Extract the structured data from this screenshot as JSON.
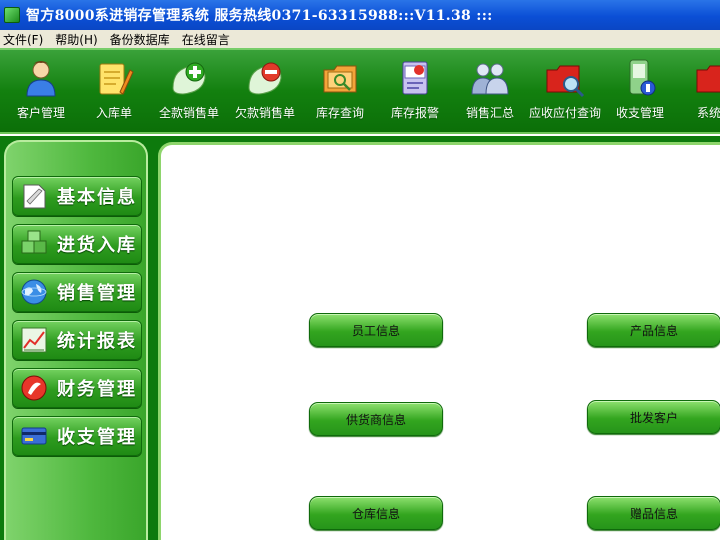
{
  "window": {
    "title": "智方8000系进销存管理系统 服务热线0371-63315988:::V11.38 :::"
  },
  "menu": {
    "items": [
      {
        "label": "文件(F)"
      },
      {
        "label": "帮助(H)"
      },
      {
        "label": "备份数据库"
      },
      {
        "label": "在线留言"
      }
    ]
  },
  "toolbar": {
    "buttons": [
      {
        "label": "客户管理",
        "icon": "person-icon"
      },
      {
        "label": "入库单",
        "icon": "notepad-pencil-icon"
      },
      {
        "label": "全款销售单",
        "icon": "plus-leaf-icon"
      },
      {
        "label": "欠款销售单",
        "icon": "minus-leaf-icon"
      },
      {
        "label": "库存查询",
        "icon": "folder-search-icon"
      },
      {
        "label": "库存报警",
        "icon": "book-alarm-icon"
      },
      {
        "label": "销售汇总",
        "icon": "group-people-icon"
      },
      {
        "label": "应收应付查询",
        "icon": "red-folder-magnifier-icon"
      },
      {
        "label": "收支管理",
        "icon": "phone-money-icon"
      },
      {
        "label": "系统设",
        "icon": "red-folder-icon"
      }
    ]
  },
  "sidebar": {
    "items": [
      {
        "label": "基本信息",
        "icon": "document-icon"
      },
      {
        "label": "进货入库",
        "icon": "boxes-icon"
      },
      {
        "label": "销售管理",
        "icon": "globe-icon"
      },
      {
        "label": "统计报表",
        "icon": "line-chart-icon"
      },
      {
        "label": "财务管理",
        "icon": "red-seal-icon"
      },
      {
        "label": "收支管理",
        "icon": "card-icon"
      }
    ]
  },
  "main": {
    "buttons": [
      {
        "label": "员工信息"
      },
      {
        "label": "产品信息"
      },
      {
        "label": "供货商信息"
      },
      {
        "label": "批发客户"
      },
      {
        "label": "仓库信息"
      },
      {
        "label": "赠品信息"
      }
    ]
  },
  "colors": {
    "accent_green": "#13800f",
    "button_green": "#33a51f",
    "title_blue": "#0b4fd6"
  }
}
